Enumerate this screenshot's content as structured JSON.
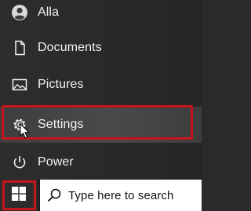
{
  "start_menu": {
    "user": {
      "label": "Alla",
      "icon": "user-avatar-icon"
    },
    "documents": {
      "label": "Documents",
      "icon": "document-icon"
    },
    "pictures": {
      "label": "Pictures",
      "icon": "pictures-icon"
    },
    "settings": {
      "label": "Settings",
      "icon": "gear-icon"
    },
    "power": {
      "label": "Power",
      "icon": "power-icon"
    }
  },
  "taskbar": {
    "start_icon": "windows-logo-icon",
    "search": {
      "placeholder": "Type here to search",
      "icon": "search-icon"
    }
  },
  "highlight_color": "#c6141c",
  "accent_text": "#f2f2f2"
}
